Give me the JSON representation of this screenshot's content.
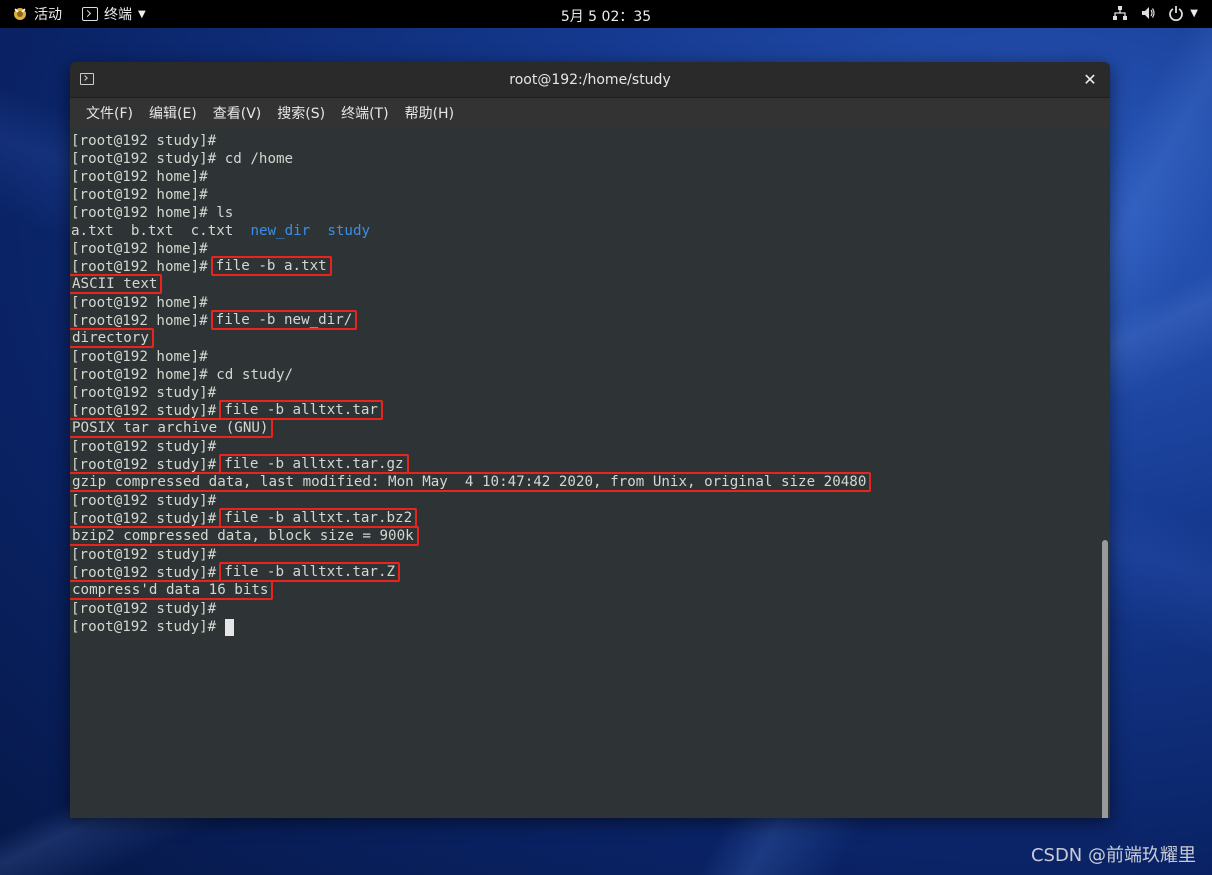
{
  "topbar": {
    "activities_label": "活动",
    "app_label": "终端",
    "clock": "5月 5 02：35"
  },
  "window": {
    "title": "root@192:/home/study",
    "close_glyph": "✕",
    "menu": [
      "文件(F)",
      "编辑(E)",
      "查看(V)",
      "搜索(S)",
      "终端(T)",
      "帮助(H)"
    ]
  },
  "terminal": {
    "lines": [
      {
        "prompt": "[root@192 study]#",
        "cmd": ""
      },
      {
        "prompt": "[root@192 study]#",
        "cmd": " cd /home"
      },
      {
        "prompt": "[root@192 home]#",
        "cmd": ""
      },
      {
        "prompt": "[root@192 home]#",
        "cmd": ""
      },
      {
        "prompt": "[root@192 home]#",
        "cmd": " ls"
      },
      {
        "ls": [
          "a.txt",
          "b.txt",
          "c.txt",
          "new_dir",
          "study"
        ]
      },
      {
        "prompt": "[root@192 home]#",
        "cmd": ""
      },
      {
        "prompt": "[root@192 home]#",
        "cmd_hl": "file -b a.txt"
      },
      {
        "out_hl": "ASCII text"
      },
      {
        "prompt": "[root@192 home]#",
        "cmd": ""
      },
      {
        "prompt": "[root@192 home]#",
        "cmd_hl": "file -b new_dir/"
      },
      {
        "out_hl": "directory"
      },
      {
        "prompt": "[root@192 home]#",
        "cmd": ""
      },
      {
        "prompt": "[root@192 home]#",
        "cmd": " cd study/"
      },
      {
        "prompt": "[root@192 study]#",
        "cmd": ""
      },
      {
        "prompt": "[root@192 study]#",
        "cmd_hl": "file -b alltxt.tar"
      },
      {
        "out_hl": "POSIX tar archive (GNU)"
      },
      {
        "prompt": "[root@192 study]#",
        "cmd": ""
      },
      {
        "prompt": "[root@192 study]#",
        "cmd_hl": "file -b alltxt.tar.gz"
      },
      {
        "out_hl": "gzip compressed data, last modified: Mon May  4 10:47:42 2020, from Unix, original size 20480"
      },
      {
        "prompt": "[root@192 study]#",
        "cmd": ""
      },
      {
        "prompt": "[root@192 study]#",
        "cmd_hl": "file -b alltxt.tar.bz2"
      },
      {
        "out_hl": "bzip2 compressed data, block size = 900k"
      },
      {
        "prompt": "[root@192 study]#",
        "cmd": ""
      },
      {
        "prompt": "[root@192 study]#",
        "cmd_hl": "file -b alltxt.tar.Z"
      },
      {
        "out_hl": "compress'd data 16 bits"
      },
      {
        "prompt": "[root@192 study]#",
        "cmd": ""
      },
      {
        "prompt": "[root@192 study]#",
        "cmd": " ",
        "cursor": true
      }
    ],
    "colors": {
      "text": "#d3d7cf",
      "directory": "#3a8fe8",
      "highlight": "#e8241d",
      "background": "#2e3436"
    }
  },
  "watermark": "CSDN @前端玖耀里"
}
